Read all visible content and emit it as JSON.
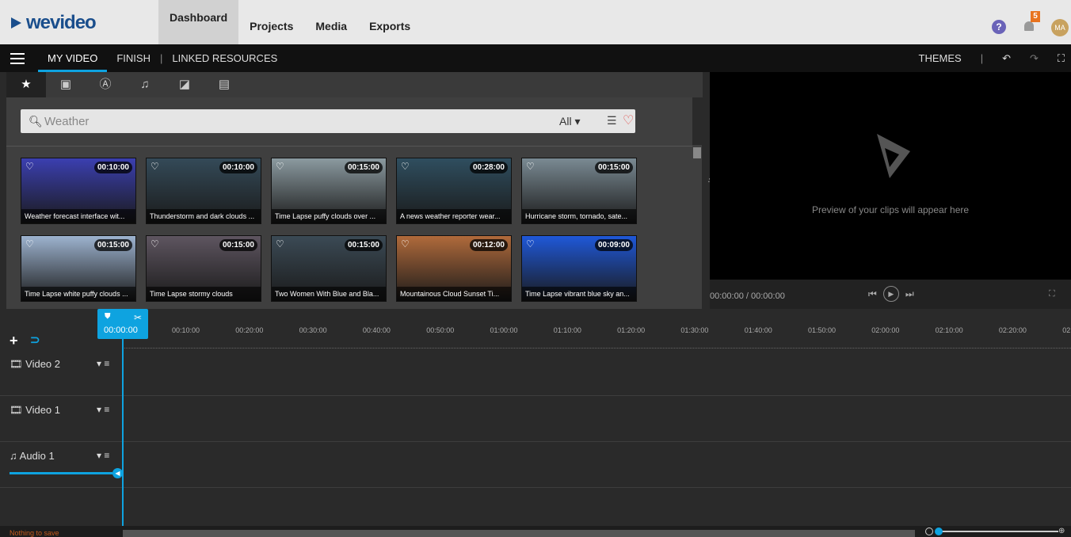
{
  "brand": {
    "logo_text": "wevideo"
  },
  "topnav": {
    "items": [
      "Dashboard",
      "Projects",
      "Media",
      "Exports"
    ],
    "active": "Dashboard"
  },
  "header": {
    "help": "?",
    "notifications": "5",
    "avatar": "MA"
  },
  "secondary": {
    "tabs": [
      "MY VIDEO",
      "FINISH",
      "LINKED RESOURCES"
    ],
    "active": "MY VIDEO",
    "themes": "THEMES"
  },
  "media": {
    "search": {
      "value": "Weather",
      "filter": "All"
    },
    "items": [
      {
        "title": "Weather forecast interface wit...",
        "duration": "00:10:00",
        "color": "#3b3fb0"
      },
      {
        "title": "Thunderstorm and dark clouds ...",
        "duration": "00:10:00",
        "color": "#344a58"
      },
      {
        "title": "Time Lapse puffy clouds over ...",
        "duration": "00:15:00",
        "color": "#8b9aa0"
      },
      {
        "title": "A news weather reporter wear...",
        "duration": "00:28:00",
        "color": "#2f4e5f"
      },
      {
        "title": "Hurricane storm, tornado, sate...",
        "duration": "00:15:00",
        "color": "#7a8a93"
      },
      {
        "title": "Time Lapse white puffy clouds ...",
        "duration": "00:15:00",
        "color": "#9db3cf"
      },
      {
        "title": "Time Lapse stormy clouds",
        "duration": "00:15:00",
        "color": "#5e5560"
      },
      {
        "title": "Two Women With Blue and Bla...",
        "duration": "00:15:00",
        "color": "#3b4a55"
      },
      {
        "title": "Mountainous Cloud Sunset Ti...",
        "duration": "00:12:00",
        "color": "#b06a3b"
      },
      {
        "title": "Time Lapse vibrant blue sky an...",
        "duration": "00:09:00",
        "color": "#1f58d8"
      }
    ]
  },
  "preview": {
    "text": "Preview of your clips will appear here",
    "time": "00:00:00 / 00:00:00"
  },
  "timeline": {
    "playhead": "00:00:00",
    "ticks": [
      "00:10:00",
      "00:20:00",
      "00:30:00",
      "00:40:00",
      "00:50:00",
      "01:00:00",
      "01:10:00",
      "01:20:00",
      "01:30:00",
      "01:40:00",
      "01:50:00",
      "02:00:00",
      "02:10:00",
      "02:20:00",
      "02"
    ],
    "tracks": [
      "Video 2",
      "Video 1",
      "Audio 1"
    ]
  },
  "status": {
    "save": "Nothing to save"
  },
  "colors": {
    "accent": "#0ea3e0",
    "brand": "#1a4e8c",
    "badge": "#e8731e"
  }
}
